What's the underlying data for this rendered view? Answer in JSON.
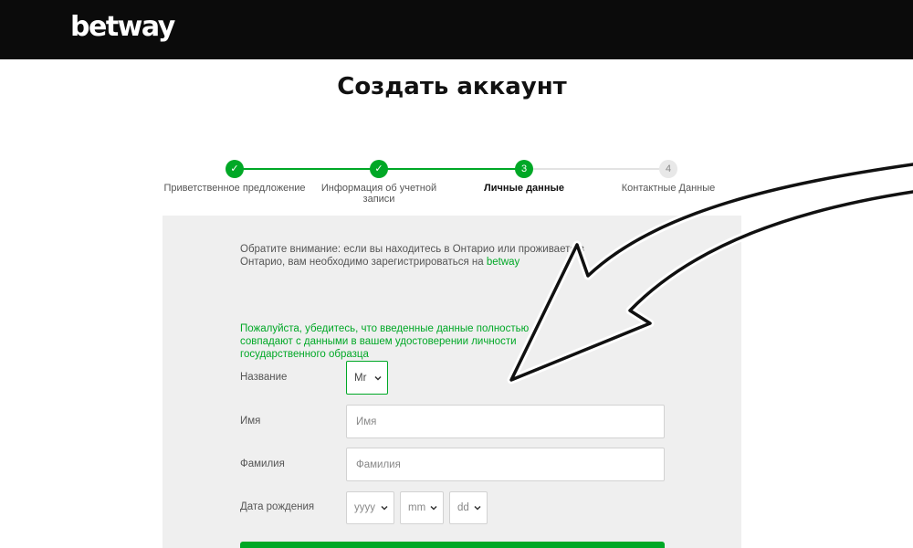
{
  "header": {
    "logo": "betway"
  },
  "page": {
    "title": "Создать аккаунт"
  },
  "steps": [
    {
      "number": "✓",
      "label": "Приветственное предложение",
      "state": "done"
    },
    {
      "number": "✓",
      "label": "Информация об учетной записи",
      "state": "done"
    },
    {
      "number": "3",
      "label": "Личные данные",
      "state": "active"
    },
    {
      "number": "4",
      "label": "Контактные Данные",
      "state": "todo"
    }
  ],
  "form": {
    "notice": {
      "text": "Обратите внимание: если вы находитесь в Онтарио или проживаете в Онтарио, вам необходимо зарегистрироваться на ",
      "link": "betway"
    },
    "verify_notice": "Пожалуйста, убедитесь, что введенные данные полностью совпадают с данными в вашем удостоверении личности государственного образца",
    "title_label": "Название",
    "title_value": "Mr",
    "first_name_label": "Имя",
    "first_name_placeholder": "Имя",
    "last_name_label": "Фамилия",
    "last_name_placeholder": "Фамилия",
    "dob_label": "Дата рождения",
    "dob_year": "yyyy",
    "dob_month": "mm",
    "dob_day": "dd"
  },
  "colors": {
    "accent": "#00a826",
    "header_bg": "#0b0b0b",
    "panel_bg": "#efefef"
  }
}
